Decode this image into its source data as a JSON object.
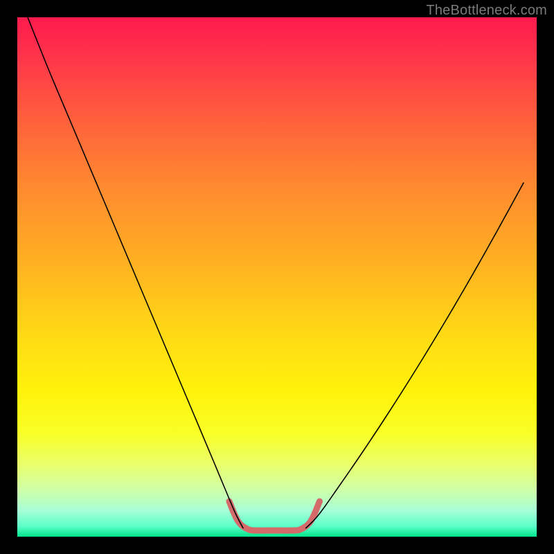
{
  "watermark": "TheBottleneck.com",
  "chart_data": {
    "type": "line",
    "title": "",
    "xlabel": "",
    "ylabel": "",
    "xlim": [
      0,
      100
    ],
    "ylim": [
      0,
      100
    ],
    "grid": false,
    "legend": false,
    "gradient_colors": {
      "top": "#ff1a4c",
      "middle": "#fff20a",
      "bottom": "#00e58b"
    },
    "series": [
      {
        "name": "left-branch",
        "stroke": "#000000",
        "stroke_width": 1.6,
        "x": [
          2,
          6,
          10,
          14,
          18,
          22,
          26,
          30,
          34,
          38,
          40,
          42,
          43.5
        ],
        "y": [
          100,
          90,
          80.5,
          71,
          61.5,
          52,
          42.5,
          33,
          23.5,
          14,
          9.2,
          4.5,
          1.6
        ]
      },
      {
        "name": "right-branch",
        "stroke": "#000000",
        "stroke_width": 1.6,
        "x": [
          55.5,
          58,
          62,
          66,
          70,
          74,
          78,
          82,
          86,
          90,
          94,
          97.5
        ],
        "y": [
          1.6,
          4.2,
          9.8,
          15.6,
          21.6,
          27.8,
          34.2,
          40.8,
          47.6,
          54.6,
          61.8,
          68.2
        ]
      },
      {
        "name": "bottleneck-highlight",
        "stroke": "#d46a6a",
        "stroke_width": 9,
        "linecap": "round",
        "x": [
          40.8,
          42.5,
          44.5,
          46.5,
          48.5,
          50.5,
          52.5,
          54.5,
          56.5,
          58.2
        ],
        "y": [
          6.8,
          3.0,
          1.4,
          1.2,
          1.2,
          1.2,
          1.2,
          1.4,
          3.0,
          6.8
        ]
      }
    ]
  }
}
